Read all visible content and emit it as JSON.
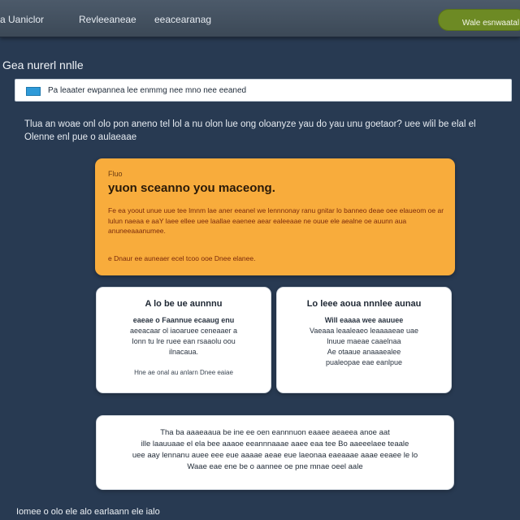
{
  "nav": {
    "links": [
      "a  Uaniclor",
      "Revleeaneae",
      "eeacearanag"
    ],
    "button_label": "Wale esnwaatal"
  },
  "page": {
    "title": "Gea nurerl nnlle"
  },
  "search": {
    "text": "Pa leaater ewpannea lee enmmg nee mno nee eeaned"
  },
  "intro": {
    "text": "Tlua an woae onl olo pon aneno tel lol a nu olon lue ong oloanyze yau do yau unu goetaor? uee wlil be elal el Olenne enl pue o aulaeaae"
  },
  "alert": {
    "small_label": "Fluo",
    "heading": "yuon sceanno you maceong.",
    "body": "Fe ea yoout unue uue tee lmnm lae aner eeanel we lennnonay ranu gnitar lo banneo deae oee elaueom oe ar lulun naeaa e aaY laee ellee uee laallae eaenee aear ealeeaae ne ouue ele aealne oe auunn aua anuneeaaanumee.",
    "link": "e Dnaur ee auneaer ecel tcoo ooe Dnee elanee."
  },
  "cards": [
    {
      "title": "A lo be ue aunnnu",
      "lines": [
        "eaeae o Faannue ecaaug enu",
        "aeeacaar ol iaoaruee ceneaaer a",
        "Ionn tu lre ruee ean rsaaolu oou",
        "ilnacaua."
      ],
      "foot": "Hne ae onal au anlarn Dnee eaiae"
    },
    {
      "title": "Lo leee aoua nnnlee aunau",
      "lines": [
        "Will eaaaa wee aauuee",
        "Vaeaaa leaaleaeo leaaaaeae uae",
        "lnuue maeae caaelnaa",
        "Ae otaaue anaaaealee",
        "pualeopae eae eanlpue"
      ],
      "foot": ""
    }
  ],
  "info": {
    "lines": [
      "Tha ba aaaeaaua be ine ee oen eannnuon eaaee aeaeea anoe aat",
      "ille laauuaae el ela bee aaaoe eeannnaaae aaee eaa tee Bo aaeeelaee teaale",
      "uee aay lennanu auee eee eue aaaae aeae eue laeonaa eaeaaae aaae eeaee le lo",
      "Waae eae ene be o aannee oe pne mnae oeel aale"
    ]
  },
  "footer": {
    "text": "Iomee o olo ele alo earlaann ele ialo"
  }
}
